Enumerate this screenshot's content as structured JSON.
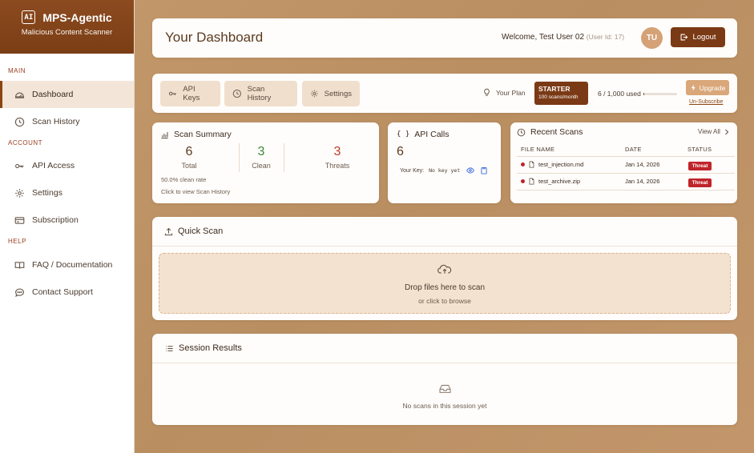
{
  "brand": {
    "logo_text": "AI",
    "title": "MPS-Agentic",
    "subtitle": "Malicious Content Scanner"
  },
  "sidebar": {
    "sections": [
      {
        "label": "MAIN",
        "items": [
          {
            "label": "Dashboard",
            "icon": "gauge-icon",
            "active": true
          },
          {
            "label": "Scan History",
            "icon": "clock-icon"
          }
        ]
      },
      {
        "label": "ACCOUNT",
        "items": [
          {
            "label": "API Access",
            "icon": "key-icon"
          },
          {
            "label": "Settings",
            "icon": "gear-icon"
          },
          {
            "label": "Subscription",
            "icon": "credit-card-icon"
          }
        ]
      },
      {
        "label": "HELP",
        "items": [
          {
            "label": "FAQ / Documentation",
            "icon": "book-icon"
          },
          {
            "label": "Contact Support",
            "icon": "chat-icon"
          }
        ]
      }
    ]
  },
  "header": {
    "title": "Your Dashboard",
    "welcome": "Welcome, Test User 02",
    "user_id": "(User Id: 17)",
    "avatar_initials": "TU",
    "logout_label": "Logout"
  },
  "toolbar": {
    "api_keys": "API Keys",
    "scan_history": "Scan History",
    "settings": "Settings",
    "your_plan": "Your Plan",
    "plan_name": "STARTER",
    "plan_quota": "100 scans/month",
    "usage": "6 / 1,000 used",
    "usage_fraction": 0.006,
    "upgrade": "Upgrade",
    "unsubscribe": "Un-Subscribe"
  },
  "summary": {
    "title": "Scan Summary",
    "total": "6",
    "total_label": "Total",
    "clean": "3",
    "clean_label": "Clean",
    "threats": "3",
    "threats_label": "Threats",
    "clean_rate": "50.0% clean rate",
    "hint": "Click to view Scan History",
    "clean_color": "#3a8a3a",
    "threat_color": "#c0392b"
  },
  "api": {
    "title": "API Calls",
    "count": "6",
    "key_label": "Your Key:",
    "key_value": "No key yet"
  },
  "recent": {
    "title": "Recent Scans",
    "view_all": "View All",
    "columns": [
      "FILE NAME",
      "DATE",
      "STATUS"
    ],
    "rows": [
      {
        "file": "test_injection.md",
        "date": "Jan 14, 2026",
        "status": "Threat"
      },
      {
        "file": "test_archive.zip",
        "date": "Jan 14, 2026",
        "status": "Threat"
      }
    ]
  },
  "quick_scan": {
    "title": "Quick Scan",
    "drop_main": "Drop files here to scan",
    "drop_sub": "or click to browse"
  },
  "session": {
    "title": "Session Results",
    "empty": "No scans in this session yet"
  }
}
